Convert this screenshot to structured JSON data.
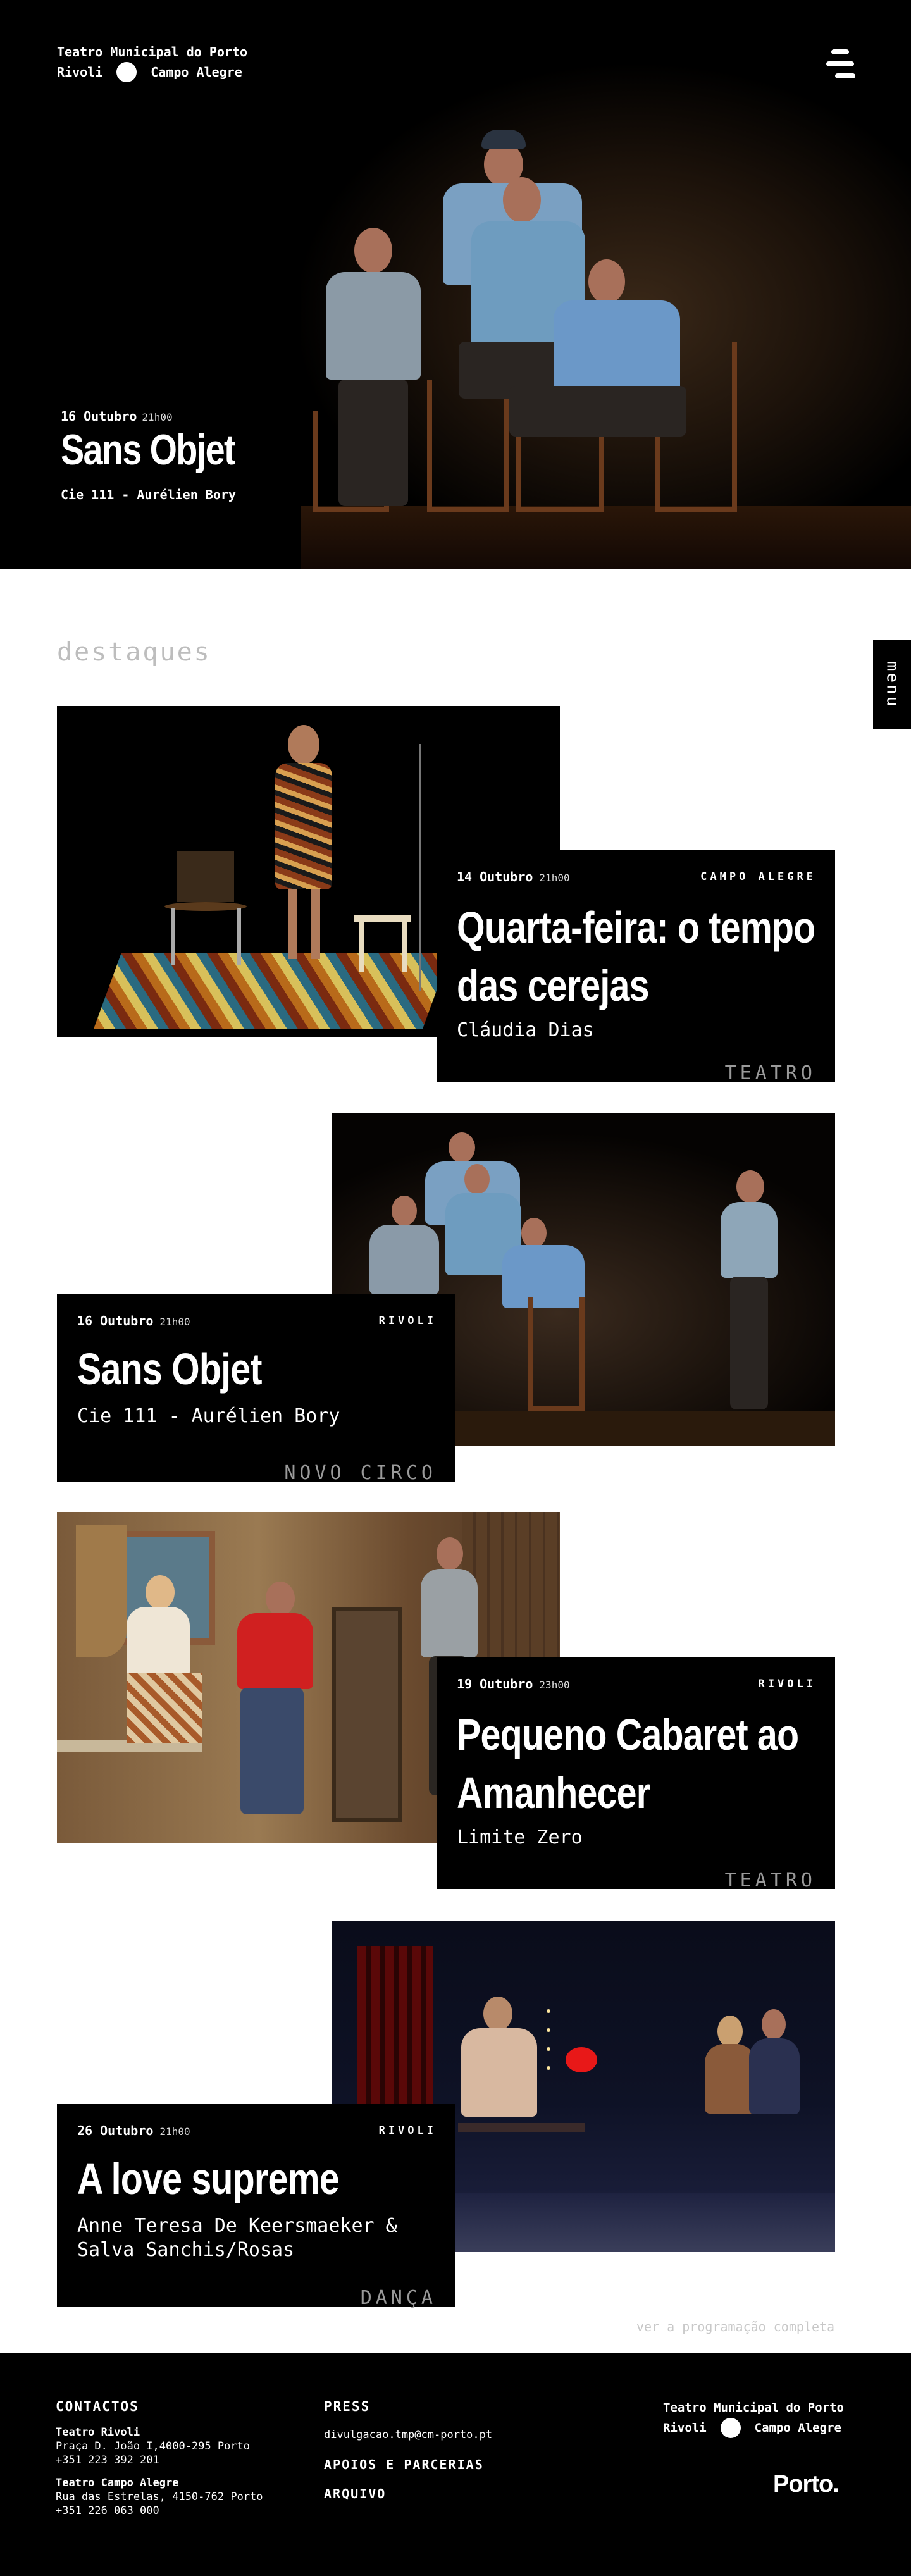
{
  "brand": {
    "line1": "Teatro Municipal do Porto",
    "venue_a": "Rivoli",
    "venue_b": "Campo Alegre"
  },
  "hero": {
    "date": "16 Outubro",
    "time": "21h00",
    "title": "Sans Objet",
    "artist": "Cie 111 - Aurélien Bory"
  },
  "menu_label": "menu",
  "section_title": "destaques",
  "cards": [
    {
      "date": "14 Outubro",
      "time": "21h00",
      "venue": "CAMPO ALEGRE",
      "title_line1": "Quarta-feira: o tempo",
      "title_line2": "das cerejas",
      "artist_line1": "Cláudia Dias",
      "artist_line2": "",
      "genre": "TEATRO"
    },
    {
      "date": "16 Outubro",
      "time": "21h00",
      "venue": "RIVOLI",
      "title_line1": "Sans Objet",
      "title_line2": "",
      "artist_line1": "Cie 111 - Aurélien Bory",
      "artist_line2": "",
      "genre": "NOVO CIRCO"
    },
    {
      "date": "19 Outubro",
      "time": "23h00",
      "venue": "RIVOLI",
      "title_line1": "Pequeno Cabaret ao",
      "title_line2": "Amanhecer",
      "artist_line1": "Limite Zero",
      "artist_line2": "",
      "genre": "TEATRO"
    },
    {
      "date": "26 Outubro",
      "time": "21h00",
      "venue": "RIVOLI",
      "title_line1": "A love supreme",
      "title_line2": "",
      "artist_line1": "Anne Teresa De Keersmaeker &",
      "artist_line2": "Salva Sanchis/Rosas",
      "genre": "DANÇA"
    }
  ],
  "see_all": "ver a programação completa",
  "footer": {
    "contacts_heading": "CONTACTOS",
    "rivoli_name": "Teatro Rivoli",
    "rivoli_address": "Praça D. João I,4000-295 Porto",
    "rivoli_phone": "+351 223 392 201",
    "campo_name": "Teatro Campo Alegre",
    "campo_address": "Rua das Estrelas, 4150-762 Porto",
    "campo_phone": "+351 226 063 000",
    "press_heading": "PRESS",
    "press_email": "divulgacao.tmp@cm-porto.pt",
    "partners_link": "APOIOS E PARCERIAS",
    "archive_link": "ARQUIVO",
    "brand_line1": "Teatro Municipal do Porto",
    "brand_venue_a": "Rivoli",
    "brand_venue_b": "Campo Alegre",
    "porto_logo": "Porto."
  },
  "colors": {
    "background": "#ffffff",
    "card": "#000000",
    "section_title": "#bdbdbd",
    "genre": "#9a9a9a"
  }
}
